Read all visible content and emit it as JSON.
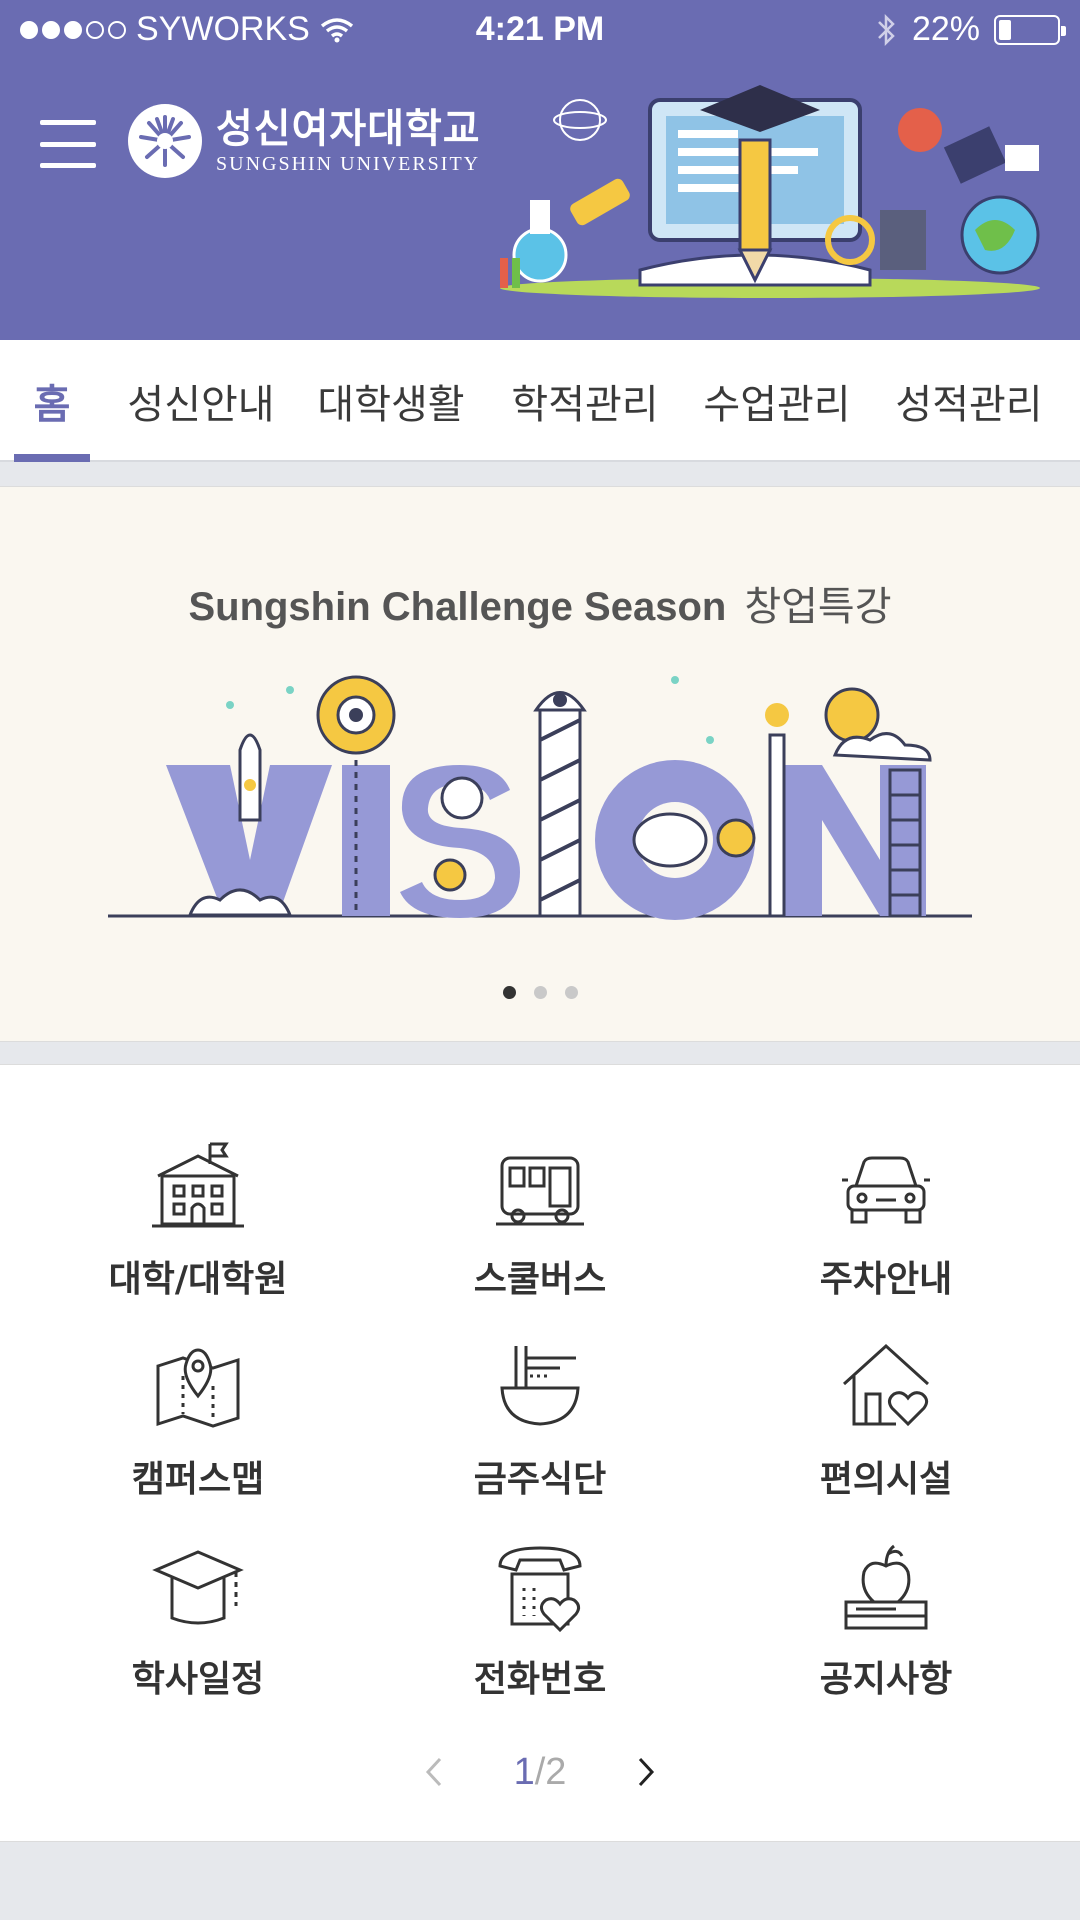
{
  "status_bar": {
    "carrier": "SYWORKS",
    "time": "4:21 PM",
    "battery_percent_text": "22%",
    "battery_level": 0.22,
    "signal_bars_on": 3,
    "signal_bars_total": 5
  },
  "brand": {
    "name_ko": "성신여자대학교",
    "name_en": "SUNGSHIN UNIVERSITY"
  },
  "colors": {
    "primary": "#6a6cb2",
    "vision_letters": "#9699d6",
    "accent_yellow": "#f5c842"
  },
  "tabs": [
    {
      "label": "홈",
      "active": true
    },
    {
      "label": "성신안내",
      "active": false
    },
    {
      "label": "대학생활",
      "active": false
    },
    {
      "label": "학적관리",
      "active": false
    },
    {
      "label": "수업관리",
      "active": false
    },
    {
      "label": "성적관리",
      "active": false
    }
  ],
  "banner": {
    "title_en": "Sungshin Challenge Season",
    "title_ko": "창업특강",
    "art_word": "VISION",
    "slide_count": 3,
    "active_slide": 1
  },
  "menu": {
    "items": [
      {
        "label": "대학/대학원",
        "icon": "school-building-icon"
      },
      {
        "label": "스쿨버스",
        "icon": "bus-icon"
      },
      {
        "label": "주차안내",
        "icon": "car-icon"
      },
      {
        "label": "캠퍼스맵",
        "icon": "map-pin-icon"
      },
      {
        "label": "금주식단",
        "icon": "noodle-bowl-icon"
      },
      {
        "label": "편의시설",
        "icon": "house-heart-icon"
      },
      {
        "label": "학사일정",
        "icon": "graduation-cap-icon"
      },
      {
        "label": "전화번호",
        "icon": "telephone-heart-icon"
      },
      {
        "label": "공지사항",
        "icon": "apple-books-icon"
      }
    ],
    "pager": {
      "current": "1",
      "separator": "/",
      "total": "2"
    }
  }
}
